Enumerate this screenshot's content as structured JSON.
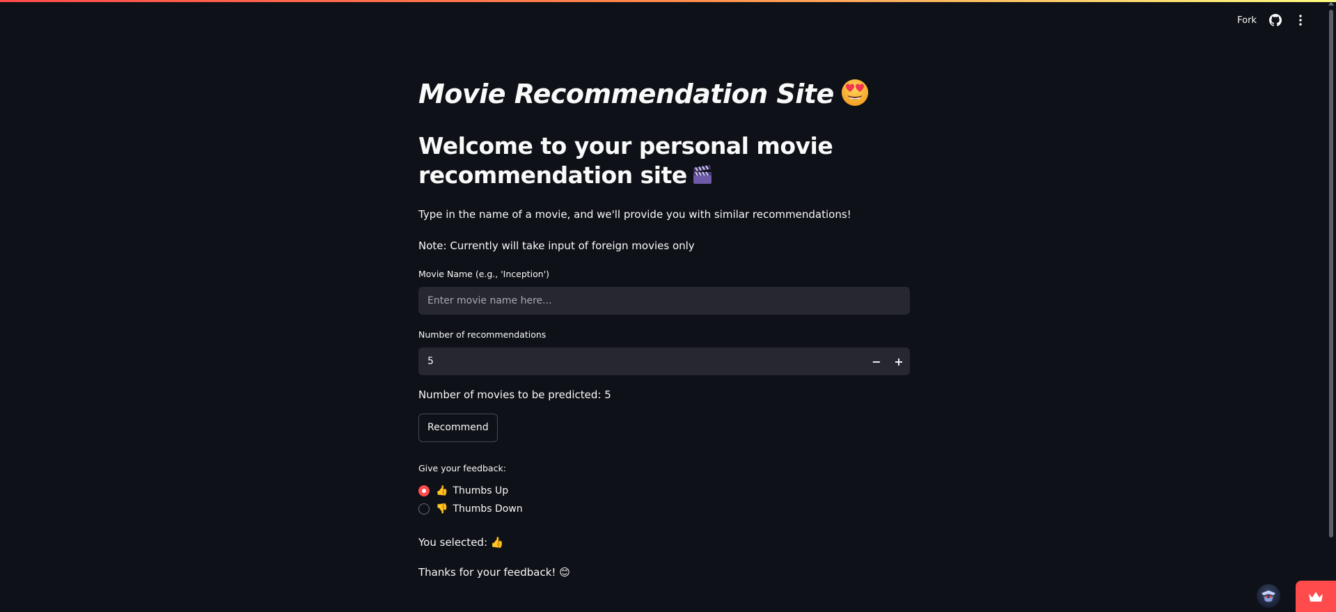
{
  "header": {
    "fork_label": "Fork",
    "github_icon": "github-icon",
    "menu_icon": "vertical-dots-icon"
  },
  "main": {
    "title": "Movie Recommendation Site",
    "title_emoji": "heart-eyes-emoji",
    "subtitle_line1": "Welcome to your personal movie",
    "subtitle_line2": "recommendation site",
    "subtitle_emoji": "clapper-board-emoji",
    "intro_text": "Type in the name of a movie, and we'll provide you with similar recommendations!",
    "note_text": "Note: Currently will take input of foreign movies only",
    "movie_input": {
      "label": "Movie Name (e.g., 'Inception')",
      "placeholder": "Enter movie name here...",
      "value": ""
    },
    "num_input": {
      "label": "Number of recommendations",
      "value": "5",
      "minus": "−",
      "plus": "+"
    },
    "predicted_text": "Number of movies to be predicted: 5",
    "recommend_button": "Recommend",
    "feedback": {
      "label": "Give your feedback:",
      "options": [
        {
          "emoji": "👍",
          "label": "Thumbs Up",
          "selected": true
        },
        {
          "emoji": "👎",
          "label": "Thumbs Down",
          "selected": false
        }
      ],
      "selected_prefix": "You selected:",
      "selected_emoji": "👍",
      "thanks_text": "Thanks for your feedback!",
      "thanks_emoji": "😊"
    }
  },
  "colors": {
    "background": "#0e1117",
    "input_bg": "#262730",
    "accent": "#ff4b4b",
    "text": "#fafafa"
  }
}
